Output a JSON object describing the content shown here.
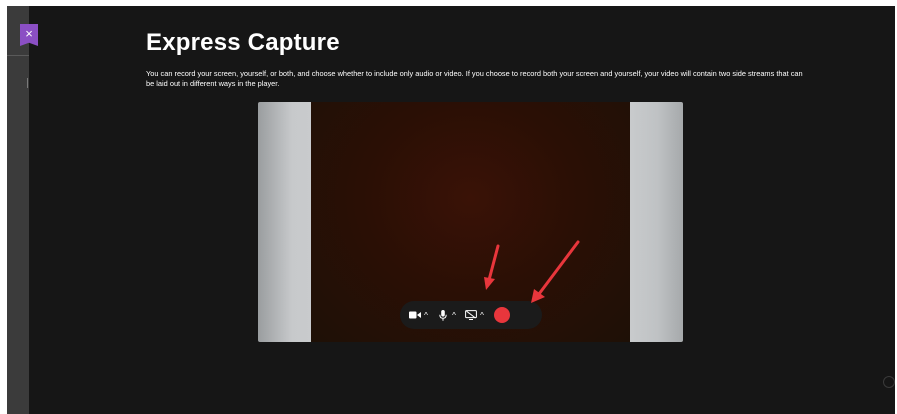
{
  "page": {
    "title": "Express Capture",
    "description": "You can record your screen, yourself, or both, and choose whether to include only audio or video. If you choose to record both your screen and yourself, your video will contain two side streams that can be laid out in different ways in the player."
  },
  "close_tab": {
    "icon": "close-icon",
    "glyph": "×",
    "color": "#8b4fc4"
  },
  "toolbar": {
    "camera_icon": "camera-icon",
    "microphone_icon": "microphone-icon",
    "screen_share_icon": "screen-share-off-icon",
    "caret": "^",
    "record_button_color": "#e8363c"
  },
  "annotations": {
    "arrow_color": "#e8363c"
  },
  "colors": {
    "background": "#161616",
    "accent": "#8b4fc4"
  }
}
